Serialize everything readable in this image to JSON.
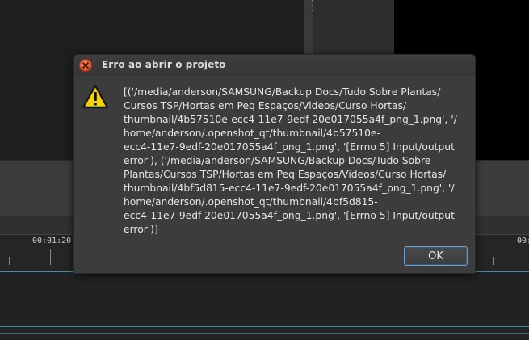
{
  "background": {
    "timeline": {
      "left_label": "00:01:20",
      "right_label": "00:"
    }
  },
  "dialog": {
    "title": "Erro ao abrir o projeto",
    "close_icon": "close-icon",
    "warning_icon": "warning-icon",
    "message": "[('/media/anderson/SAMSUNG/Backup Docs/Tudo Sobre Plantas/\nCursos TSP/Hortas em Peq Espaços/Videos/Curso Hortas/\nthumbnail/4b57510e-ecc4-11e7-9edf-20e017055a4f_png_1.png', '/\nhome/anderson/.openshot_qt/thumbnail/4b57510e-\necc4-11e7-9edf-20e017055a4f_png_1.png', '[Errno 5] Input/output\nerror'), ('/media/anderson/SAMSUNG/Backup Docs/Tudo Sobre\nPlantas/Cursos TSP/Hortas em Peq Espaços/Videos/Curso Hortas/\nthumbnail/4bf5d815-ecc4-11e7-9edf-20e017055a4f_png_1.png', '/\nhome/anderson/.openshot_qt/thumbnail/4bf5d815-\necc4-11e7-9edf-20e017055a4f_png_1.png', '[Errno 5] Input/output\nerror')]",
    "ok_label": "OK"
  },
  "colors": {
    "close_button": "#e0502b",
    "ok_border": "#6a9fd0",
    "track_line": "#3f8fb5"
  }
}
